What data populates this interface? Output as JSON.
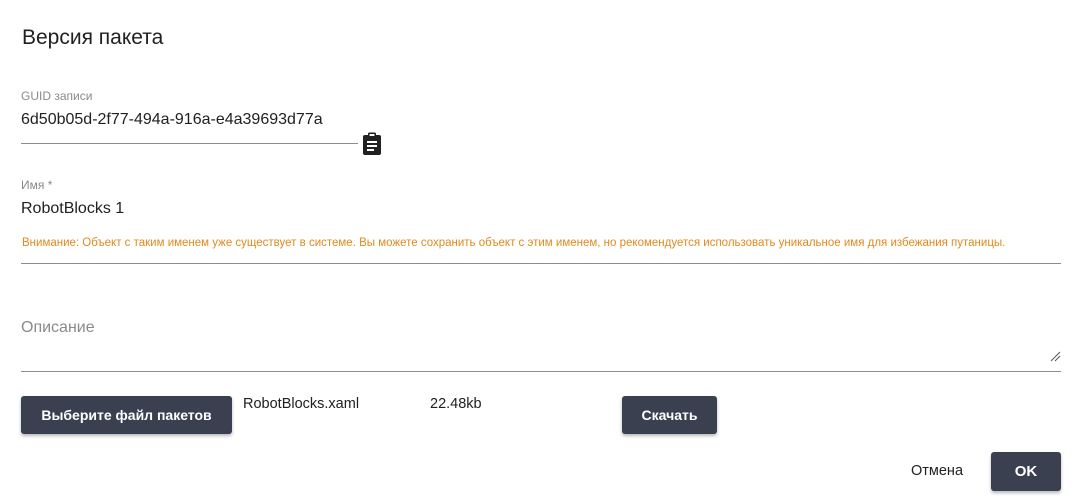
{
  "dialog": {
    "title": "Версия пакета"
  },
  "guid_field": {
    "label": "GUID записи",
    "value": "6d50b05d-2f77-494a-916a-e4a39693d77a",
    "copy_icon": "clipboard-icon"
  },
  "name_field": {
    "label": "Имя *",
    "value": "RobotBlocks 1",
    "warning": "Внимание: Объект с таким именем уже существует в системе. Вы можете сохранить объект с этим именем, но рекомендуется использовать уникальное имя для избежания путаницы."
  },
  "description_field": {
    "placeholder": "Описание",
    "value": ""
  },
  "file": {
    "select_button": "Выберите файл пакетов",
    "name": "RobotBlocks.xaml",
    "size": "22.48kb",
    "download_button": "Скачать"
  },
  "actions": {
    "cancel": "Отмена",
    "ok": "OK"
  },
  "colors": {
    "primary_button": "#3b4050",
    "warning_text": "#e08a1e",
    "label_text": "#8a8a8a"
  }
}
